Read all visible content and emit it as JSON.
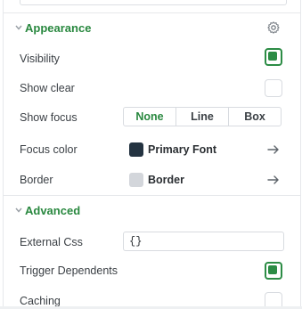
{
  "appearance": {
    "title": "Appearance",
    "rows": {
      "visibility": {
        "label": "Visibility",
        "checked": true
      },
      "show_clear": {
        "label": "Show clear",
        "checked": false
      },
      "show_focus": {
        "label": "Show focus",
        "options": [
          "None",
          "Line",
          "Box"
        ],
        "selected": "None"
      },
      "focus_color": {
        "label": "Focus color",
        "value": "Primary Font",
        "swatch": "#243341"
      },
      "border": {
        "label": "Border",
        "value": "Border",
        "swatch": "#d3d6db"
      }
    }
  },
  "advanced": {
    "title": "Advanced",
    "rows": {
      "external_css": {
        "label": "External Css",
        "value": "{}"
      },
      "trigger_dependents": {
        "label": "Trigger Dependents",
        "checked": true
      },
      "caching": {
        "label": "Caching",
        "checked": false
      }
    }
  },
  "colors": {
    "accent": "#29883f"
  }
}
